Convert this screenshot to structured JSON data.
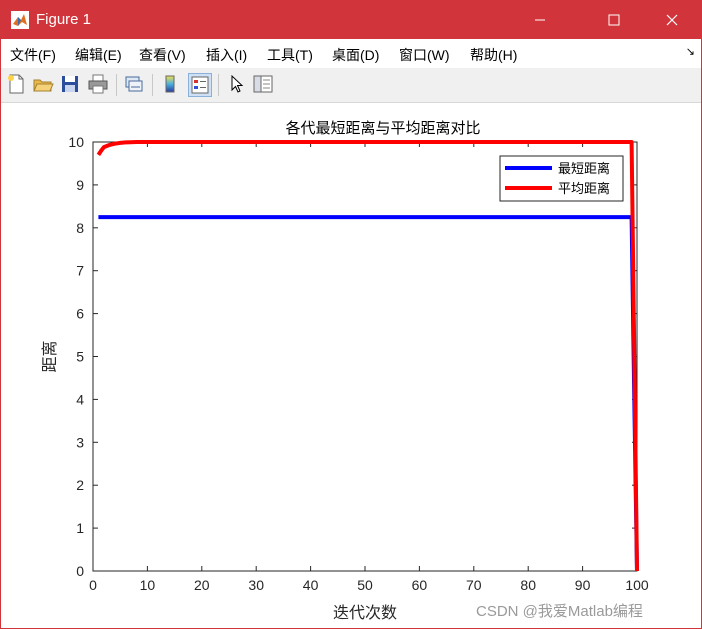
{
  "window": {
    "title": "Figure 1",
    "icon": "matlab-icon",
    "controls": [
      "minimize-icon",
      "maximize-icon",
      "close-icon"
    ],
    "accent_color": "#d1343a"
  },
  "menu": {
    "items": [
      "文件(F)",
      "编辑(E)",
      "查看(V)",
      "插入(I)",
      "工具(T)",
      "桌面(D)",
      "窗口(W)",
      "帮助(H)"
    ],
    "overflow_icon": "dock-arrow-icon"
  },
  "toolbar": {
    "icons": [
      "new-figure-icon",
      "open-file-icon",
      "save-icon",
      "print-icon",
      "link-plot-icon",
      "insert-colorbar-icon",
      "insert-legend-icon",
      "edit-plot-pointer-icon",
      "property-inspector-icon"
    ]
  },
  "chart_data": {
    "type": "line",
    "title": "各代最短距离与平均距离对比",
    "xlabel": "迭代次数",
    "ylabel": "距离",
    "xlim": [
      0,
      100
    ],
    "ylim": [
      0,
      10
    ],
    "xticks": [
      "0",
      "10",
      "20",
      "30",
      "40",
      "50",
      "60",
      "70",
      "80",
      "90",
      "100"
    ],
    "yticks": [
      "0",
      "1",
      "2",
      "3",
      "4",
      "5",
      "6",
      "7",
      "8",
      "9",
      "10"
    ],
    "grid": false,
    "legend_position": "top-right",
    "series": [
      {
        "name": "最短距离",
        "color": "#0000ff",
        "x": [
          1,
          99,
          99.5,
          100
        ],
        "y": [
          8.25,
          8.25,
          4.0,
          0
        ]
      },
      {
        "name": "平均距离",
        "color": "#ff0000",
        "x": [
          1,
          1.5,
          2,
          3,
          4,
          5,
          6,
          8,
          10,
          20,
          40,
          60,
          80,
          99,
          100
        ],
        "y": [
          9.7,
          9.8,
          9.88,
          9.93,
          9.96,
          9.98,
          9.99,
          10,
          10,
          10,
          10,
          10,
          10,
          10,
          0
        ]
      }
    ]
  },
  "watermark": "CSDN @我爱Matlab编程"
}
